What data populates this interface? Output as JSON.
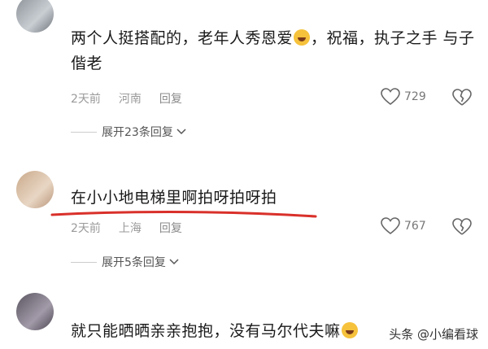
{
  "comments": [
    {
      "text_a": "两个人挺搭配的，老年人秀恩爱",
      "text_b": "，祝福，执子之手 与子",
      "text_c": "偕老",
      "time": "2天前",
      "location": "河南",
      "reply": "回复",
      "likes": "729",
      "expand": "展开23条回复"
    },
    {
      "text": "在小小地电梯里啊拍呀拍呀拍",
      "time": "2天前",
      "location": "上海",
      "reply": "回复",
      "likes": "767",
      "expand": "展开5条回复"
    },
    {
      "text": "就只能晒晒亲亲抱抱，没有马尔代夫嘛"
    }
  ],
  "watermark": "头条 @小编看球",
  "colors": {
    "underline": "#d9302a",
    "emoji": "#f6c23b"
  }
}
